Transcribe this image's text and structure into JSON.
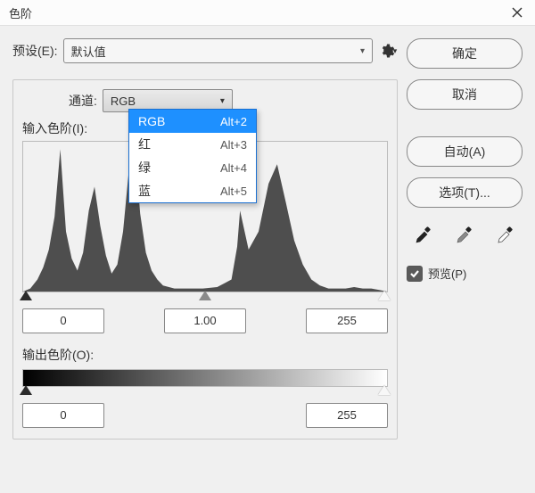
{
  "window": {
    "title": "色阶"
  },
  "preset": {
    "label": "预设(E):",
    "value": "默认值"
  },
  "channel": {
    "label": "通道:",
    "value": "RGB",
    "options": [
      {
        "label": "RGB",
        "shortcut": "Alt+2"
      },
      {
        "label": "红",
        "shortcut": "Alt+3"
      },
      {
        "label": "绿",
        "shortcut": "Alt+4"
      },
      {
        "label": "蓝",
        "shortcut": "Alt+5"
      }
    ]
  },
  "input_levels": {
    "label": "输入色阶(I):",
    "shadow": "0",
    "mid": "1.00",
    "highlight": "255"
  },
  "output_levels": {
    "label": "输出色阶(O):",
    "low": "0",
    "high": "255"
  },
  "buttons": {
    "ok": "确定",
    "cancel": "取消",
    "auto": "自动(A)",
    "options": "选项(T)..."
  },
  "preview": {
    "label": "预览(P)",
    "checked": true
  },
  "icons": {
    "close": "close-icon",
    "gear": "gear-icon",
    "chevron": "chevron-down-icon",
    "eyedropper_black": "eyedropper-black-icon",
    "eyedropper_gray": "eyedropper-gray-icon",
    "eyedropper_white": "eyedropper-white-icon"
  },
  "chart_data": {
    "type": "area",
    "title": "输入色阶(I)",
    "xlabel": "",
    "ylabel": "",
    "xlim": [
      0,
      255
    ],
    "ylim": [
      0,
      100
    ],
    "x": [
      0,
      5,
      10,
      14,
      18,
      22,
      26,
      30,
      34,
      38,
      42,
      46,
      50,
      54,
      58,
      62,
      66,
      70,
      74,
      78,
      82,
      86,
      90,
      94,
      98,
      106,
      116,
      126,
      136,
      146,
      150,
      152,
      158,
      165,
      172,
      178,
      184,
      190,
      196,
      202,
      208,
      214,
      220,
      226,
      232,
      238,
      244,
      250,
      255
    ],
    "values": [
      0,
      2,
      8,
      16,
      28,
      50,
      95,
      40,
      22,
      14,
      26,
      54,
      70,
      44,
      24,
      12,
      18,
      40,
      80,
      100,
      52,
      26,
      14,
      8,
      4,
      2,
      2,
      2,
      3,
      8,
      30,
      54,
      28,
      40,
      72,
      85,
      60,
      34,
      18,
      8,
      4,
      2,
      2,
      2,
      3,
      2,
      2,
      1,
      0
    ]
  }
}
